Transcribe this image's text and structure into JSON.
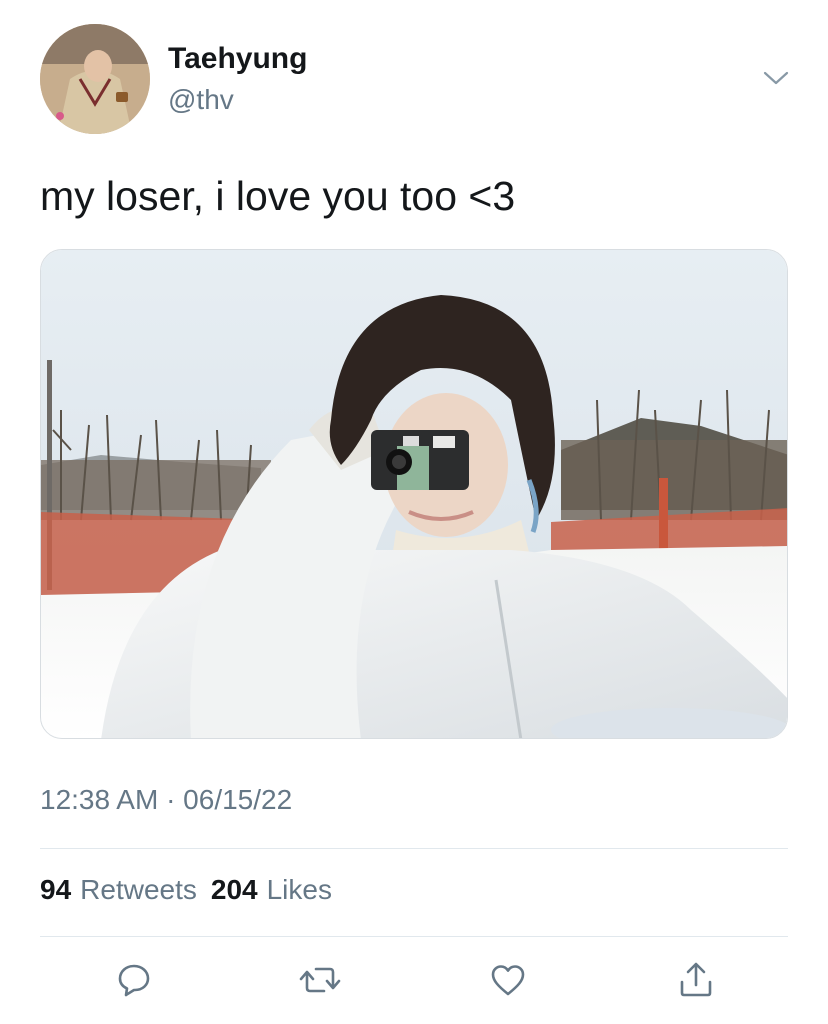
{
  "user": {
    "name": "Taehyung",
    "handle": "@thv",
    "avatar_icon": "profile-photo"
  },
  "tweet": {
    "text": "my loser, i love you too <3",
    "media": "photo",
    "timestamp": "12:38 AM · 06/15/22"
  },
  "stats": {
    "retweets_count": "94",
    "retweets_label": "Retweets",
    "likes_count": "204",
    "likes_label": "Likes"
  },
  "actions": [
    "reply-icon",
    "retweet-icon",
    "like-icon",
    "share-icon"
  ],
  "colors": {
    "text_primary": "#14171a",
    "text_secondary": "#657786",
    "divider": "#e1e8ed",
    "icon": "#657786"
  }
}
